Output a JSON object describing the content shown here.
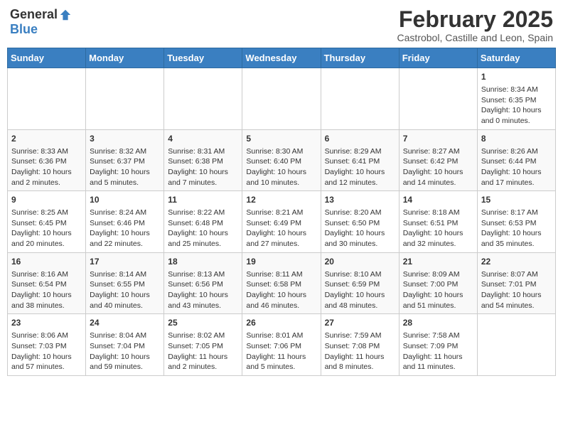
{
  "header": {
    "logo": {
      "general": "General",
      "blue": "Blue"
    },
    "month": "February 2025",
    "location": "Castrobol, Castille and Leon, Spain"
  },
  "weekdays": [
    "Sunday",
    "Monday",
    "Tuesday",
    "Wednesday",
    "Thursday",
    "Friday",
    "Saturday"
  ],
  "weeks": [
    [
      {
        "day": "",
        "content": ""
      },
      {
        "day": "",
        "content": ""
      },
      {
        "day": "",
        "content": ""
      },
      {
        "day": "",
        "content": ""
      },
      {
        "day": "",
        "content": ""
      },
      {
        "day": "",
        "content": ""
      },
      {
        "day": "1",
        "content": "Sunrise: 8:34 AM\nSunset: 6:35 PM\nDaylight: 10 hours and 0 minutes."
      }
    ],
    [
      {
        "day": "2",
        "content": "Sunrise: 8:33 AM\nSunset: 6:36 PM\nDaylight: 10 hours and 2 minutes."
      },
      {
        "day": "3",
        "content": "Sunrise: 8:32 AM\nSunset: 6:37 PM\nDaylight: 10 hours and 5 minutes."
      },
      {
        "day": "4",
        "content": "Sunrise: 8:31 AM\nSunset: 6:38 PM\nDaylight: 10 hours and 7 minutes."
      },
      {
        "day": "5",
        "content": "Sunrise: 8:30 AM\nSunset: 6:40 PM\nDaylight: 10 hours and 10 minutes."
      },
      {
        "day": "6",
        "content": "Sunrise: 8:29 AM\nSunset: 6:41 PM\nDaylight: 10 hours and 12 minutes."
      },
      {
        "day": "7",
        "content": "Sunrise: 8:27 AM\nSunset: 6:42 PM\nDaylight: 10 hours and 14 minutes."
      },
      {
        "day": "8",
        "content": "Sunrise: 8:26 AM\nSunset: 6:44 PM\nDaylight: 10 hours and 17 minutes."
      }
    ],
    [
      {
        "day": "9",
        "content": "Sunrise: 8:25 AM\nSunset: 6:45 PM\nDaylight: 10 hours and 20 minutes."
      },
      {
        "day": "10",
        "content": "Sunrise: 8:24 AM\nSunset: 6:46 PM\nDaylight: 10 hours and 22 minutes."
      },
      {
        "day": "11",
        "content": "Sunrise: 8:22 AM\nSunset: 6:48 PM\nDaylight: 10 hours and 25 minutes."
      },
      {
        "day": "12",
        "content": "Sunrise: 8:21 AM\nSunset: 6:49 PM\nDaylight: 10 hours and 27 minutes."
      },
      {
        "day": "13",
        "content": "Sunrise: 8:20 AM\nSunset: 6:50 PM\nDaylight: 10 hours and 30 minutes."
      },
      {
        "day": "14",
        "content": "Sunrise: 8:18 AM\nSunset: 6:51 PM\nDaylight: 10 hours and 32 minutes."
      },
      {
        "day": "15",
        "content": "Sunrise: 8:17 AM\nSunset: 6:53 PM\nDaylight: 10 hours and 35 minutes."
      }
    ],
    [
      {
        "day": "16",
        "content": "Sunrise: 8:16 AM\nSunset: 6:54 PM\nDaylight: 10 hours and 38 minutes."
      },
      {
        "day": "17",
        "content": "Sunrise: 8:14 AM\nSunset: 6:55 PM\nDaylight: 10 hours and 40 minutes."
      },
      {
        "day": "18",
        "content": "Sunrise: 8:13 AM\nSunset: 6:56 PM\nDaylight: 10 hours and 43 minutes."
      },
      {
        "day": "19",
        "content": "Sunrise: 8:11 AM\nSunset: 6:58 PM\nDaylight: 10 hours and 46 minutes."
      },
      {
        "day": "20",
        "content": "Sunrise: 8:10 AM\nSunset: 6:59 PM\nDaylight: 10 hours and 48 minutes."
      },
      {
        "day": "21",
        "content": "Sunrise: 8:09 AM\nSunset: 7:00 PM\nDaylight: 10 hours and 51 minutes."
      },
      {
        "day": "22",
        "content": "Sunrise: 8:07 AM\nSunset: 7:01 PM\nDaylight: 10 hours and 54 minutes."
      }
    ],
    [
      {
        "day": "23",
        "content": "Sunrise: 8:06 AM\nSunset: 7:03 PM\nDaylight: 10 hours and 57 minutes."
      },
      {
        "day": "24",
        "content": "Sunrise: 8:04 AM\nSunset: 7:04 PM\nDaylight: 10 hours and 59 minutes."
      },
      {
        "day": "25",
        "content": "Sunrise: 8:02 AM\nSunset: 7:05 PM\nDaylight: 11 hours and 2 minutes."
      },
      {
        "day": "26",
        "content": "Sunrise: 8:01 AM\nSunset: 7:06 PM\nDaylight: 11 hours and 5 minutes."
      },
      {
        "day": "27",
        "content": "Sunrise: 7:59 AM\nSunset: 7:08 PM\nDaylight: 11 hours and 8 minutes."
      },
      {
        "day": "28",
        "content": "Sunrise: 7:58 AM\nSunset: 7:09 PM\nDaylight: 11 hours and 11 minutes."
      },
      {
        "day": "",
        "content": ""
      }
    ]
  ]
}
